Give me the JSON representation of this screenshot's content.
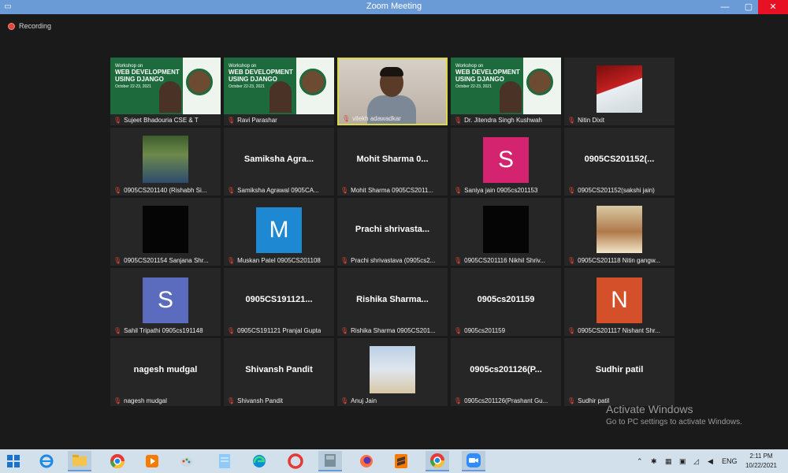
{
  "window": {
    "title": "Zoom Meeting",
    "app_icon": "zoom-icon"
  },
  "status": {
    "recording_label": "Recording"
  },
  "colors": {
    "accent": "#6b9bd6",
    "active_speaker": "#d9d94a",
    "mic_muted": "#e0463a"
  },
  "tiles": [
    {
      "name": "Sujeet Bhadouria CSE & T",
      "kind": "slide"
    },
    {
      "name": "Ravi Parashar",
      "kind": "slide"
    },
    {
      "name": "vilekh adawadkar",
      "kind": "webcam",
      "active": true
    },
    {
      "name": "Dr. Jitendra Singh Kushwah",
      "kind": "slide"
    },
    {
      "name": "Nitin Dixit",
      "kind": "photo"
    },
    {
      "name": "0905CS201140 (Rishabh Si...",
      "kind": "photo"
    },
    {
      "name": "Samiksha Agrawal 0905CA...",
      "display": "Samiksha  Agra...",
      "kind": "text"
    },
    {
      "name": "Mohit Sharma 0905CS2011...",
      "display": "Mohit  Sharma  0...",
      "kind": "text"
    },
    {
      "name": "Saniya jain 0905cs201153",
      "avatar": "S",
      "avatar_color": "#d4236f",
      "kind": "avatar"
    },
    {
      "name": "0905CS201152(sakshi jain)",
      "display": "0905CS201152(...",
      "kind": "text"
    },
    {
      "name": "0905CS201154 Sanjana Shr...",
      "kind": "black"
    },
    {
      "name": "Muskan Patel 0905CS201108",
      "avatar": "M",
      "avatar_color": "#1e88d2",
      "kind": "avatar"
    },
    {
      "name": "Prachi shrivastava (0905cs2...",
      "display": "Prachi  shrivasta...",
      "kind": "text"
    },
    {
      "name": "0905CS201116 Nikhil Shriv...",
      "kind": "black"
    },
    {
      "name": "0905CS201118 Nitin gangw...",
      "kind": "photo"
    },
    {
      "name": "Sahil Tripathi 0905cs191148",
      "avatar": "S",
      "avatar_color": "#5b6bbd",
      "kind": "avatar"
    },
    {
      "name": "0905CS191121 Pranjal Gupta",
      "display": "0905CS191121...",
      "kind": "text"
    },
    {
      "name": "Rishika Sharma 0905CS201...",
      "display": "Rishika  Sharma...",
      "kind": "text"
    },
    {
      "name": "0905cs201159",
      "display": "0905cs201159",
      "kind": "text"
    },
    {
      "name": "0905CS201117 Nishant Shr...",
      "avatar": "N",
      "avatar_color": "#d4502a",
      "kind": "avatar"
    },
    {
      "name": "nagesh mudgal",
      "display": "nagesh mudgal",
      "kind": "text"
    },
    {
      "name": "Shivansh Pandit",
      "display": "Shivansh Pandit",
      "kind": "text"
    },
    {
      "name": "Anuj Jain",
      "kind": "photo"
    },
    {
      "name": "0905cs201126(Prashant Gu...",
      "display": "0905cs201126(P...",
      "kind": "text"
    },
    {
      "name": "Sudhir patil",
      "display": "Sudhir patil",
      "kind": "text"
    }
  ],
  "slide": {
    "workshop": "Workshop on",
    "title1": "WEB DEVELOPMENT",
    "title2": "USING DJANGO",
    "dates": "October 22-23, 2021"
  },
  "watermark": {
    "line1": "Activate Windows",
    "line2": "Go to PC settings to activate Windows."
  },
  "taskbar": {
    "apps": [
      "windows-start-icon",
      "internet-explorer-icon",
      "file-explorer-icon",
      "chrome-icon",
      "media-player-icon",
      "paint-icon",
      "notepad-icon",
      "edge-icon",
      "opera-icon",
      "book-icon",
      "firefox-icon",
      "sublime-text-icon",
      "chrome-icon",
      "zoom-icon"
    ],
    "language": "ENG",
    "time": "2:11 PM",
    "date": "10/22/2021"
  }
}
